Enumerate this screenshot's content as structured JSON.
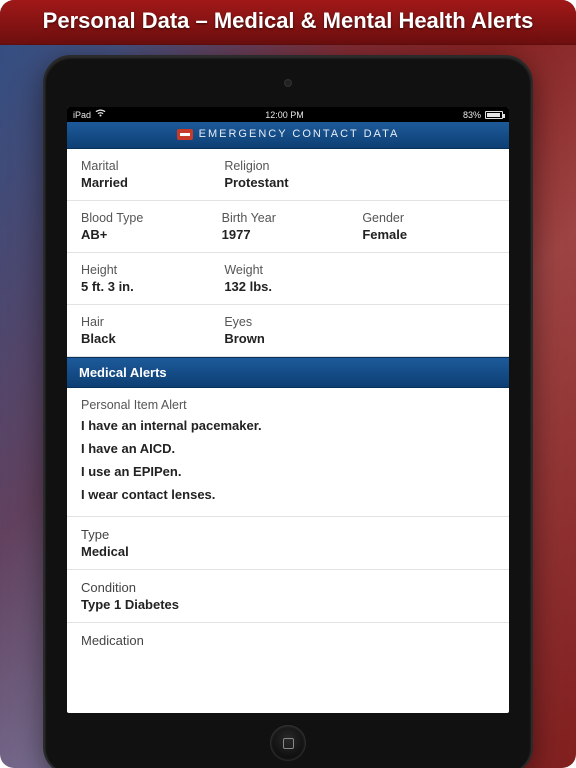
{
  "title": "Personal Data – Medical & Mental Health Alerts",
  "status": {
    "carrier": "iPad",
    "wifi_icon": "wifi-icon",
    "time": "12:00 PM",
    "battery_pct": "83%"
  },
  "app_header": "EMERGENCY CONTACT DATA",
  "personal": {
    "marital": {
      "label": "Marital",
      "value": "Married"
    },
    "religion": {
      "label": "Religion",
      "value": "Protestant"
    },
    "blood": {
      "label": "Blood Type",
      "value": "AB+"
    },
    "birth": {
      "label": "Birth Year",
      "value": "1977"
    },
    "gender": {
      "label": "Gender",
      "value": "Female"
    },
    "height": {
      "label": "Height",
      "value": "5 ft. 3 in."
    },
    "weight": {
      "label": "Weight",
      "value": "132 lbs."
    },
    "hair": {
      "label": "Hair",
      "value": "Black"
    },
    "eyes": {
      "label": "Eyes",
      "value": "Brown"
    }
  },
  "sections": {
    "medical_alerts": "Medical Alerts"
  },
  "alert": {
    "label": "Personal Item Alert",
    "lines": [
      "I have an internal pacemaker.",
      "I have an AICD.",
      "I use an EPIPen.",
      "I wear contact lenses."
    ]
  },
  "type": {
    "label": "Type",
    "value": "Medical"
  },
  "condition": {
    "label": "Condition",
    "value": "Type 1 Diabetes"
  },
  "medication": {
    "label": "Medication"
  }
}
